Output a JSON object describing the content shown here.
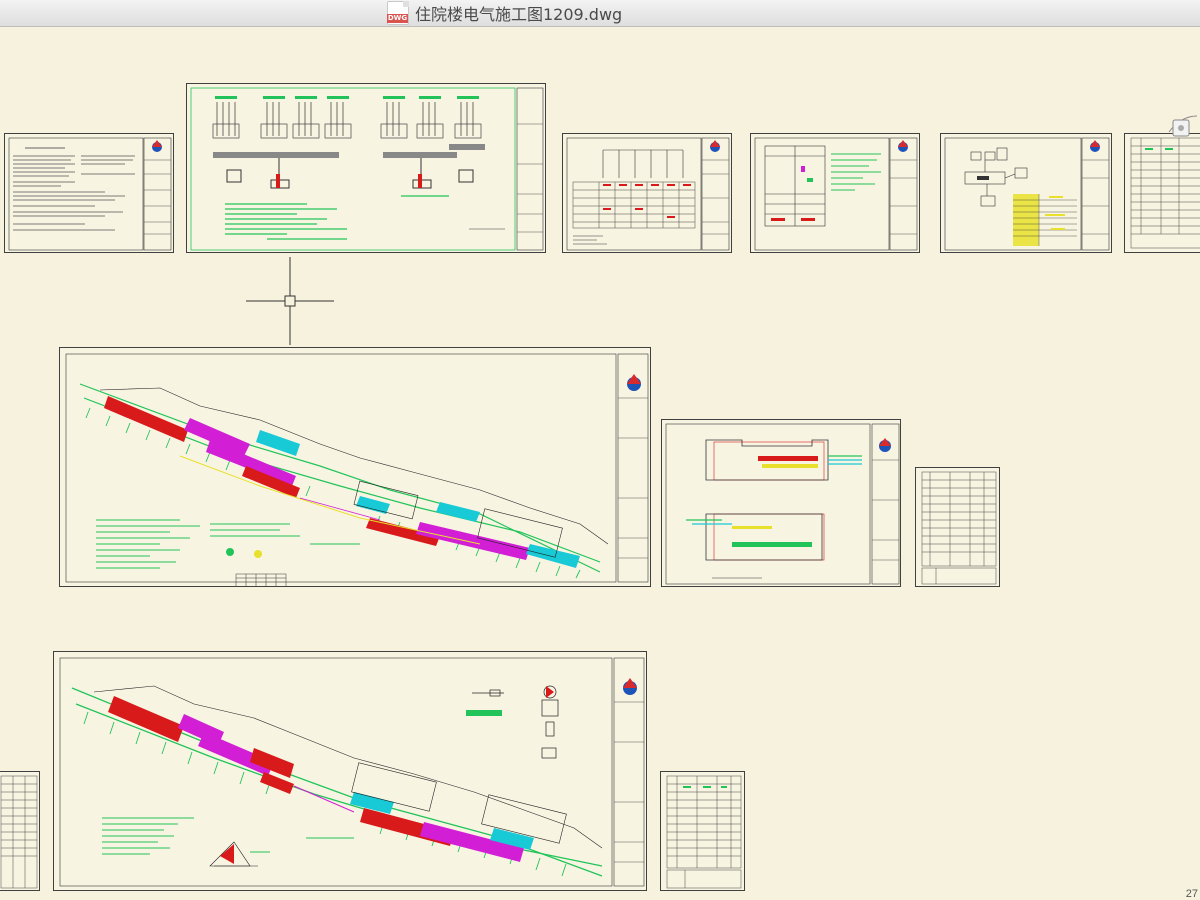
{
  "window": {
    "title": "住院楼电气施工图1209.dwg",
    "file_type_badge": "DWG",
    "file_icon": "dwg-file-icon"
  },
  "canvas": {
    "background": "#f7f2de",
    "cursor": "crosshair-cursor",
    "page_counter": "27"
  },
  "colors": {
    "green": "#22c45a",
    "cyan": "#18c9d6",
    "magenta": "#d21fd6",
    "red": "#d91a1a",
    "yellow": "#e8e02a",
    "white": "#ffffff",
    "border": "#404040"
  },
  "sheets": [
    "design-notes-sheet",
    "distribution-system-diagram-sheet",
    "distribution-box-diagram-sheet",
    "panel-schematic-sheet",
    "equipment-wiring-sheet",
    "material-list-sheet-top",
    "floor-power-plan-sheet",
    "room-layout-plan-sheet",
    "material-list-sheet-middle",
    "floor-lighting-plan-sheet",
    "legend-sheet-left",
    "material-list-sheet-bottom"
  ]
}
